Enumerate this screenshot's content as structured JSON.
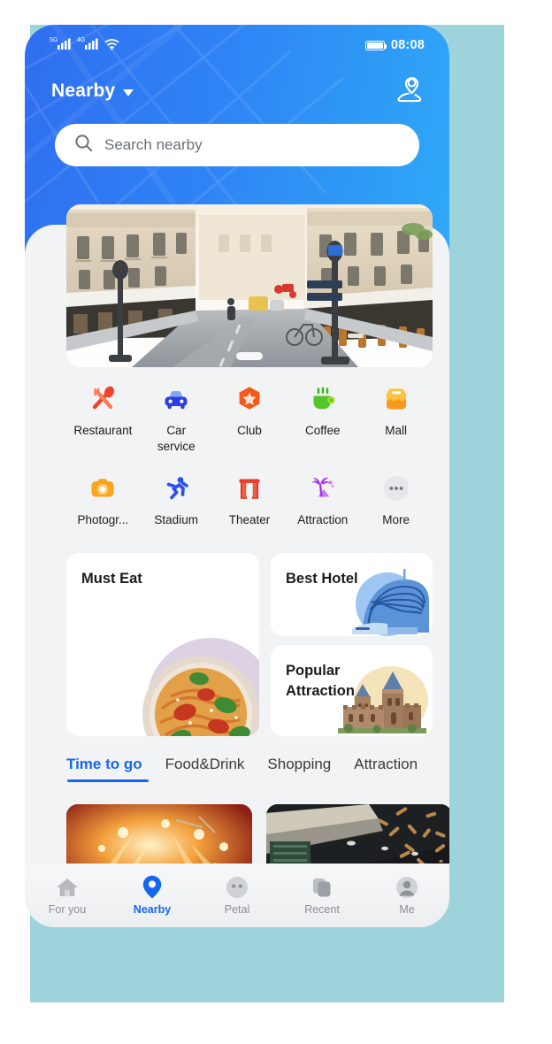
{
  "theme": {
    "header_blue_start": "#2f6ef0",
    "header_blue_end": "#2ea9f7",
    "accent": "#1667f0",
    "backdrop_teal": "#9ed3dc",
    "page_bg": "#f2f3f5"
  },
  "status_bar": {
    "signal_1": "5G",
    "signal_2": "4G",
    "wifi_icon": "wifi-icon",
    "battery_icon": "battery-icon",
    "time": "08:08"
  },
  "header": {
    "location_title": "Nearby",
    "dropdown_icon": "chevron-down-icon",
    "map_pin_icon": "map-person-pin-icon"
  },
  "search": {
    "icon": "search-icon",
    "placeholder": "Search nearby",
    "value": ""
  },
  "banner": {
    "alt": "paris-street-cafes",
    "pager_icon": "page-indicator"
  },
  "categories": {
    "row1": [
      {
        "label": "Restaurant",
        "icon": "restaurant-icon",
        "color": "#f2432a"
      },
      {
        "label": "Car\nservice",
        "icon": "car-icon",
        "color": "#2b3fe0"
      },
      {
        "label": "Club",
        "icon": "club-icon",
        "color": "#f8591a"
      },
      {
        "label": "Coffee",
        "icon": "coffee-icon",
        "color": "#55c62b"
      },
      {
        "label": "Mall",
        "icon": "mall-icon",
        "color": "#f79a1c"
      }
    ],
    "row2": [
      {
        "label": "Photogr...",
        "icon": "camera-icon",
        "color": "#fba51e"
      },
      {
        "label": "Stadium",
        "icon": "runner-icon",
        "color": "#2b50f0"
      },
      {
        "label": "Theater",
        "icon": "theater-curtain-icon",
        "color": "#ee3a24"
      },
      {
        "label": "Attraction",
        "icon": "palm-tree-icon",
        "color": "#a633f0"
      },
      {
        "label": "More",
        "icon": "more-dots-icon",
        "color": "#9aa0a6"
      }
    ]
  },
  "feature_cards": {
    "must_eat": {
      "title": "Must Eat",
      "image": "pasta-bowl"
    },
    "best_hotel": {
      "title": "Best Hotel",
      "image": "modern-hotel-building"
    },
    "popular_attraction": {
      "title": "Popular\nAttraction",
      "image": "castle"
    }
  },
  "tabs": [
    {
      "label": "Time to go",
      "active": true
    },
    {
      "label": "Food&Drink",
      "active": false
    },
    {
      "label": "Shopping",
      "active": false
    },
    {
      "label": "Attraction",
      "active": false
    }
  ],
  "feed": [
    {
      "image": "concert-stage-lights"
    },
    {
      "image": "dark-interior-sculpture"
    }
  ],
  "bottom_nav": [
    {
      "label": "For you",
      "icon": "home-icon",
      "active": false
    },
    {
      "label": "Nearby",
      "icon": "location-pin-icon",
      "active": true
    },
    {
      "label": "Petal",
      "icon": "petal-face-icon",
      "active": false
    },
    {
      "label": "Recent",
      "icon": "recent-cards-icon",
      "active": false
    },
    {
      "label": "Me",
      "icon": "person-icon",
      "active": false
    }
  ]
}
